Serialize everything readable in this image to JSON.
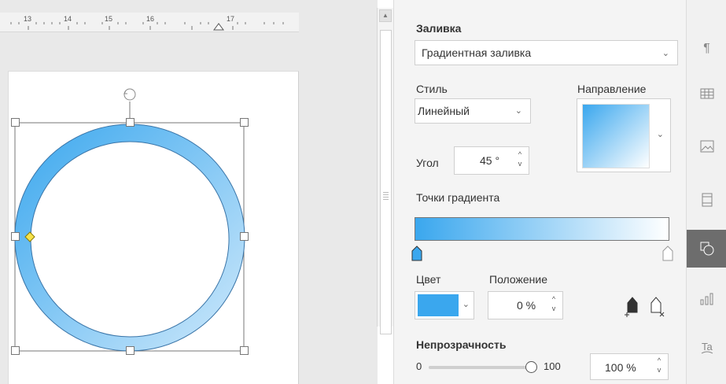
{
  "ruler": {
    "labels": [
      "13",
      "14",
      "15",
      "16",
      "17"
    ]
  },
  "panel": {
    "fill_heading": "Заливка",
    "fill_type": "Градиентная заливка",
    "style_label": "Стиль",
    "style_value": "Линейный",
    "direction_label": "Направление",
    "angle_label": "Угол",
    "angle_value": "45 °",
    "gradient_points_label": "Точки градиента",
    "color_label": "Цвет",
    "position_label": "Положение",
    "position_value": "0 %",
    "opacity_heading": "Непрозрачность",
    "opacity_min": "0",
    "opacity_max": "100",
    "opacity_value": "100 %",
    "opacity_level": 1.0,
    "gradient_start_color": "#3aa7ee",
    "gradient_end_color": "#ffffff"
  },
  "sidebar": {
    "items": [
      "paragraph-icon",
      "table-icon",
      "image-icon",
      "header-footer-icon",
      "shape-icon",
      "chart-icon",
      "text-art-icon"
    ],
    "active": "shape-icon"
  },
  "shape": {
    "type": "ring",
    "fill": "gradient",
    "accent": "#3aa7ee"
  }
}
